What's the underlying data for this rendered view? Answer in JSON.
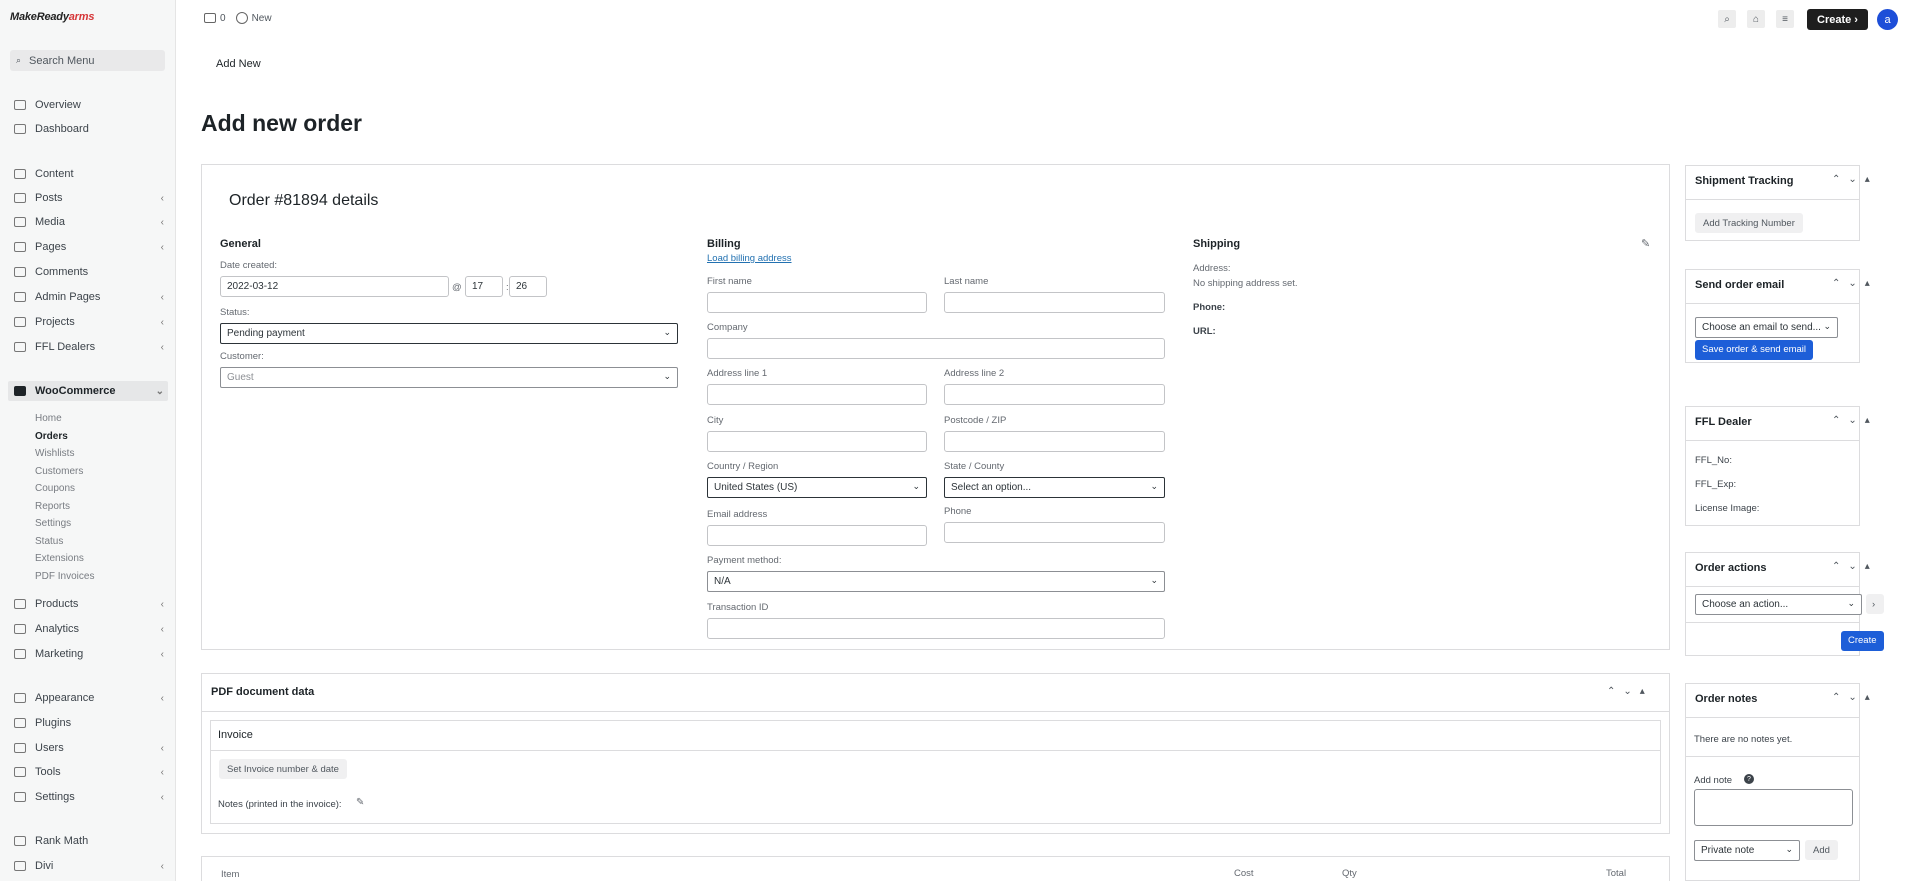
{
  "app": {
    "logo_main": "MakeReady",
    "logo_accent": "arms"
  },
  "sidebar": {
    "search_placeholder": "Search Menu",
    "items": [
      {
        "label": "Overview",
        "icon": "overview-icon"
      },
      {
        "label": "Dashboard",
        "icon": "dashboard-icon"
      },
      {
        "label": "Content",
        "icon": "content-icon"
      },
      {
        "label": "Posts",
        "icon": "posts-icon"
      },
      {
        "label": "Media",
        "icon": "media-icon"
      },
      {
        "label": "Pages",
        "icon": "pages-icon"
      },
      {
        "label": "Comments",
        "icon": "comments-icon"
      },
      {
        "label": "Admin Pages",
        "icon": "admin-pages-icon"
      },
      {
        "label": "Projects",
        "icon": "projects-icon"
      },
      {
        "label": "FFL Dealers",
        "icon": "ffl-dealers-icon"
      },
      {
        "label": "WooCommerce",
        "icon": "woocommerce-icon"
      },
      {
        "label": "Products",
        "icon": "products-icon"
      },
      {
        "label": "Analytics",
        "icon": "analytics-icon"
      },
      {
        "label": "Marketing",
        "icon": "marketing-icon"
      },
      {
        "label": "Appearance",
        "icon": "appearance-icon"
      },
      {
        "label": "Plugins",
        "icon": "plugins-icon"
      },
      {
        "label": "Users",
        "icon": "users-icon"
      },
      {
        "label": "Tools",
        "icon": "tools-icon"
      },
      {
        "label": "Settings",
        "icon": "settings-icon"
      },
      {
        "label": "Rank Math",
        "icon": "rank-math-icon"
      },
      {
        "label": "Divi",
        "icon": "divi-icon"
      }
    ],
    "woo_sub": [
      "Home",
      "Orders",
      "Wishlists",
      "Customers",
      "Coupons",
      "Reports",
      "Settings",
      "Status",
      "Extensions",
      "PDF Invoices"
    ]
  },
  "topbar": {
    "comments_count": "0",
    "new_label": "New",
    "create_label": "Create",
    "avatar_letter": "a"
  },
  "page": {
    "breadcrumb": "Add New",
    "title": "Add new order"
  },
  "order": {
    "title": "Order #81894 details",
    "general": {
      "heading": "General",
      "date_label": "Date created:",
      "date_value": "2022-03-12",
      "at": "@",
      "hour": "17",
      "minute": "26",
      "status_label": "Status:",
      "status_value": "Pending payment",
      "customer_label": "Customer:",
      "customer_value": "Guest"
    },
    "billing": {
      "heading": "Billing",
      "load_link": "Load billing address",
      "first_name": "First name",
      "last_name": "Last name",
      "company": "Company",
      "address1": "Address line 1",
      "address2": "Address line 2",
      "city": "City",
      "postcode": "Postcode / ZIP",
      "country_label": "Country / Region",
      "country_value": "United States (US)",
      "state_label": "State / County",
      "state_value": "Select an option...",
      "email": "Email address",
      "phone": "Phone",
      "payment_label": "Payment method:",
      "payment_value": "N/A",
      "transaction": "Transaction ID"
    },
    "shipping": {
      "heading": "Shipping",
      "address_label": "Address:",
      "address_value": "No shipping address set.",
      "phone_label": "Phone:",
      "url_label": "URL:"
    }
  },
  "pdf": {
    "heading": "PDF document data",
    "invoice_heading": "Invoice",
    "set_button": "Set Invoice number & date",
    "notes_label": "Notes (printed in the invoice):"
  },
  "items_table": {
    "headers": [
      "Item",
      "Cost",
      "Qty",
      "Total"
    ]
  },
  "side": {
    "tracking": {
      "heading": "Shipment Tracking",
      "button": "Add Tracking Number"
    },
    "email": {
      "heading": "Send order email",
      "select": "Choose an email to send...",
      "button": "Save order & send email"
    },
    "ffl": {
      "heading": "FFL Dealer",
      "no": "FFL_No:",
      "exp": "FFL_Exp:",
      "license": "License Image:"
    },
    "actions": {
      "heading": "Order actions",
      "select": "Choose an action...",
      "go": "›",
      "button": "Create"
    },
    "notes": {
      "heading": "Order notes",
      "empty": "There are no notes yet.",
      "add_label": "Add note",
      "type_value": "Private note",
      "add_button": "Add"
    }
  }
}
